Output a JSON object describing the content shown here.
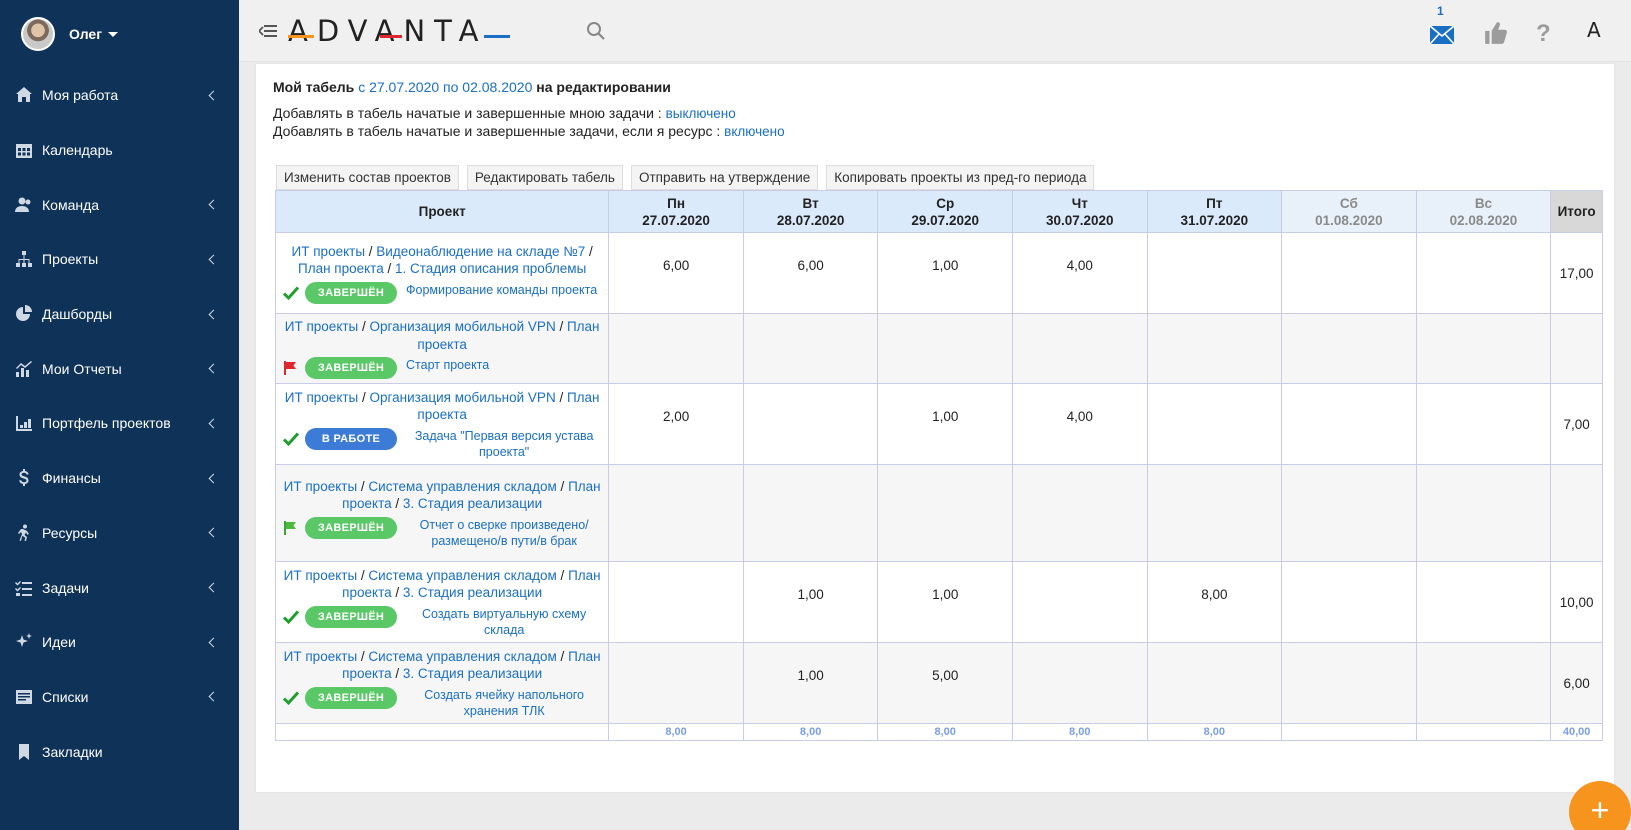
{
  "user": {
    "name": "Олег"
  },
  "nav": [
    {
      "label": "Моя работа",
      "icon": "home-icon",
      "chevron": true
    },
    {
      "label": "Календарь",
      "icon": "calendar-icon",
      "chevron": false
    },
    {
      "label": "Команда",
      "icon": "team-icon",
      "chevron": true
    },
    {
      "label": "Проекты",
      "icon": "sitemap-icon",
      "chevron": true
    },
    {
      "label": "Дашборды",
      "icon": "pie-chart-icon",
      "chevron": true
    },
    {
      "label": "Мои Отчеты",
      "icon": "bar-chart-icon",
      "chevron": true
    },
    {
      "label": "Портфель проектов",
      "icon": "portfolio-icon",
      "chevron": true
    },
    {
      "label": "Финансы",
      "icon": "dollar-icon",
      "chevron": true
    },
    {
      "label": "Ресурсы",
      "icon": "runner-icon",
      "chevron": true
    },
    {
      "label": "Задачи",
      "icon": "tasks-icon",
      "chevron": true
    },
    {
      "label": "Идеи",
      "icon": "sparkle-icon",
      "chevron": true
    },
    {
      "label": "Списки",
      "icon": "list-icon",
      "chevron": true
    },
    {
      "label": "Закладки",
      "icon": "bookmark-icon",
      "chevron": false
    }
  ],
  "header": {
    "logo": "ADVANTA",
    "mail_count": "1",
    "help": "?",
    "avatar_letter": "A"
  },
  "page": {
    "title_prefix": "Мой табель",
    "title_period": "с 27.07.2020 по 02.08.2020",
    "title_suffix": "на редактировании",
    "setting1_label": "Добавлять в табель начатые и завершенные мною задачи :",
    "setting1_value": "выключено",
    "setting2_label": "Добавлять в табель начатые и завершенные задачи, если я ресурс :",
    "setting2_value": "включено"
  },
  "toolbar": {
    "change_projects": "Изменить состав проектов",
    "edit_timesheet": "Редактировать табель",
    "send_approval": "Отправить на утверждение",
    "copy_projects": "Копировать проекты из пред-го периода"
  },
  "table": {
    "project_header": "Проект",
    "total_header": "Итого",
    "days": [
      {
        "name": "Пн",
        "date": "27.07.2020",
        "weekend": false
      },
      {
        "name": "Вт",
        "date": "28.07.2020",
        "weekend": false
      },
      {
        "name": "Ср",
        "date": "29.07.2020",
        "weekend": false
      },
      {
        "name": "Чт",
        "date": "30.07.2020",
        "weekend": false
      },
      {
        "name": "Пт",
        "date": "31.07.2020",
        "weekend": false
      },
      {
        "name": "Сб",
        "date": "01.08.2020",
        "weekend": true
      },
      {
        "name": "Вс",
        "date": "02.08.2020",
        "weekend": true
      }
    ],
    "rows": [
      {
        "path": [
          "ИТ проекты",
          "Видеонаблюдение на складе №7",
          "План проекта",
          "1. Стадия описания проблемы"
        ],
        "status_icon": "check-icon",
        "status": "ЗАВЕРШЁН",
        "status_type": "done",
        "task": "Формирование команды проекта",
        "hours": [
          "6,00",
          "6,00",
          "1,00",
          "4,00",
          "",
          "",
          ""
        ],
        "total": "17,00"
      },
      {
        "path": [
          "ИТ проекты",
          "Организация мобильной VPN",
          "План проекта"
        ],
        "status_icon": "red-flag-icon",
        "status": "ЗАВЕРШЁН",
        "status_type": "done",
        "task": "Старт проекта",
        "hours": [
          "",
          "",
          "",
          "",
          "",
          "",
          ""
        ],
        "total": ""
      },
      {
        "path": [
          "ИТ проекты",
          "Организация мобильной VPN",
          "План проекта"
        ],
        "status_icon": "check-icon",
        "status": "В РАБОТЕ",
        "status_type": "work",
        "task": "Задача \"Первая версия устава проекта\"",
        "hours": [
          "2,00",
          "",
          "1,00",
          "4,00",
          "",
          "",
          ""
        ],
        "total": "7,00"
      },
      {
        "path": [
          "ИТ проекты",
          "Система управления складом",
          "План проекта",
          "3. Стадия реализации"
        ],
        "status_icon": "green-flag-icon",
        "status": "ЗАВЕРШЁН",
        "status_type": "done",
        "task": "Отчет о сверке произведено/размещено/в пути/в брак",
        "hours": [
          "",
          "",
          "",
          "",
          "",
          "",
          ""
        ],
        "total": ""
      },
      {
        "path": [
          "ИТ проекты",
          "Система управления складом",
          "План проекта",
          "3. Стадия реализации"
        ],
        "status_icon": "check-icon",
        "status": "ЗАВЕРШЁН",
        "status_type": "done",
        "task": "Создать виртуальную схему склада",
        "hours": [
          "",
          "1,00",
          "1,00",
          "",
          "8,00",
          "",
          ""
        ],
        "total": "10,00"
      },
      {
        "path": [
          "ИТ проекты",
          "Система управления складом",
          "План проекта",
          "3. Стадия реализации"
        ],
        "status_icon": "check-icon",
        "status": "ЗАВЕРШЁН",
        "status_type": "done",
        "task": "Создать ячейку напольного хранения ТЛК",
        "hours": [
          "",
          "1,00",
          "5,00",
          "",
          "",
          "",
          ""
        ],
        "total": "6,00"
      }
    ],
    "footer": [
      "8,00",
      "8,00",
      "8,00",
      "8,00",
      "8,00",
      "",
      ""
    ],
    "footer_total": "40,00"
  },
  "fab": {
    "label": "+"
  },
  "colors": {
    "sidebar": "#0f3258",
    "accent_orange": "#f7941d",
    "link": "#1a6fc4",
    "done_badge": "#5ac866",
    "work_badge": "#3d7cd6"
  }
}
